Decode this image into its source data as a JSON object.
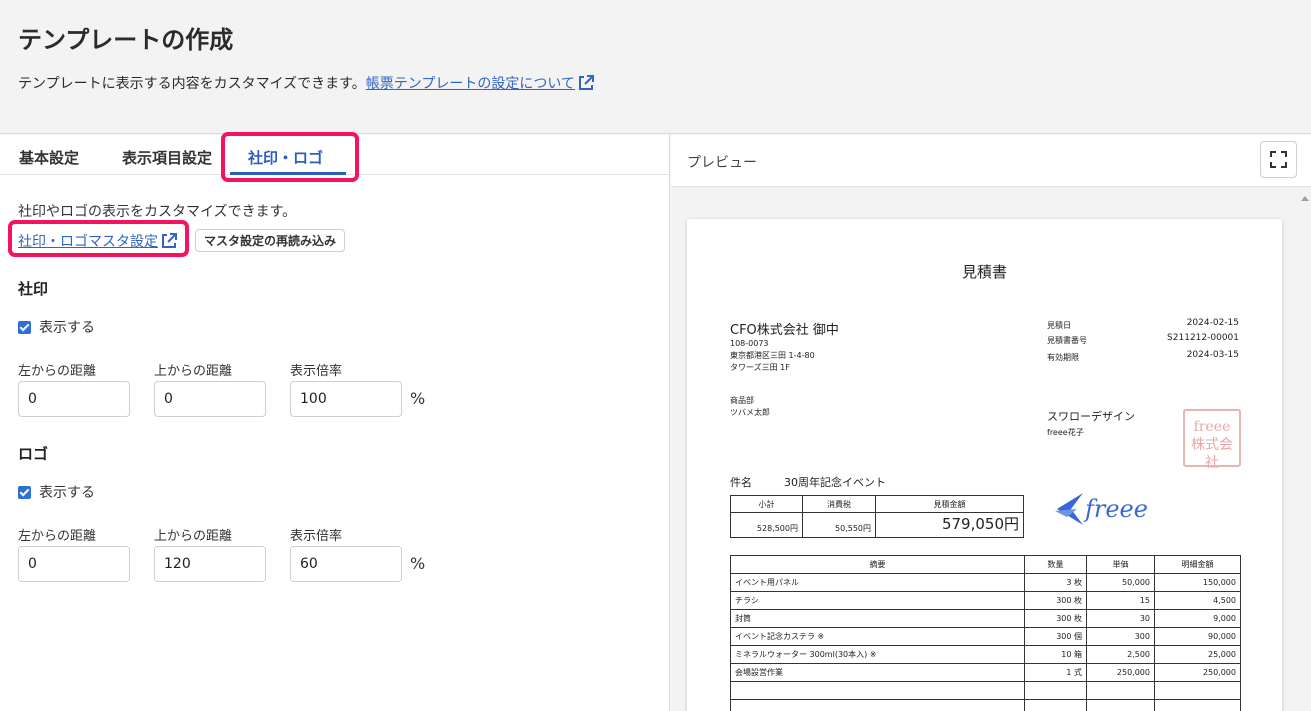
{
  "header": {
    "title": "テンプレートの作成",
    "description": "テンプレートに表示する内容をカスタマイズできます。",
    "help_link": "帳票テンプレートの設定について"
  },
  "tabs": [
    {
      "label": "基本設定"
    },
    {
      "label": "表示項目設定"
    },
    {
      "label": "社印・ロゴ",
      "active": true
    }
  ],
  "panel": {
    "description": "社印やロゴの表示をカスタマイズできます。",
    "master_link": "社印・ロゴマスタ設定",
    "reload_button": "マスタ設定の再読み込み"
  },
  "seal_section": {
    "title": "社印",
    "show_label": "表示する",
    "show_checked": true,
    "left_label": "左からの距離",
    "left_value": "0",
    "top_label": "上からの距離",
    "top_value": "0",
    "scale_label": "表示倍率",
    "scale_value": "100",
    "unit": "%"
  },
  "logo_section": {
    "title": "ロゴ",
    "show_label": "表示する",
    "show_checked": true,
    "left_label": "左からの距離",
    "left_value": "0",
    "top_label": "上からの距離",
    "top_value": "120",
    "scale_label": "表示倍率",
    "scale_value": "60",
    "unit": "%"
  },
  "preview": {
    "label": "プレビュー",
    "document": {
      "title": "見積書",
      "client_name": "CFO株式会社 御中",
      "client_zip": "108-0073",
      "client_address1": "東京都港区三田 1-4-80",
      "client_address2": "タワーズ三田 1F",
      "dept": "商品部",
      "person": "ツバメ太郎",
      "meta": [
        {
          "label": "見積日",
          "value": "2024-02-15"
        },
        {
          "label": "見積書番号",
          "value": "S211212-00001"
        },
        {
          "label": "有効期限",
          "value": "2024-03-15"
        }
      ],
      "issuer": "スワローデザイン",
      "issuer_person": "freee花子",
      "seal_line1": "freee",
      "seal_line2": "株式会社",
      "subject_label": "件名",
      "subject": "30周年記念イベント",
      "summary_headers": [
        "小計",
        "消費税",
        "見積金額"
      ],
      "summary_values": [
        "528,500円",
        "50,550円",
        "579,050円"
      ],
      "logo_text": "freee",
      "item_headers": [
        "摘要",
        "数量",
        "単価",
        "明細金額"
      ],
      "items": [
        {
          "desc": "イベント用パネル",
          "qty": "3 枚",
          "price": "50,000",
          "amount": "150,000"
        },
        {
          "desc": "チラシ",
          "qty": "300 枚",
          "price": "15",
          "amount": "4,500"
        },
        {
          "desc": "封筒",
          "qty": "300 枚",
          "price": "30",
          "amount": "9,000"
        },
        {
          "desc": "イベント記念カステラ ※",
          "qty": "300 個",
          "price": "300",
          "amount": "90,000"
        },
        {
          "desc": "ミネラルウォーター 300ml(30本入) ※",
          "qty": "10 箱",
          "price": "2,500",
          "amount": "25,000"
        },
        {
          "desc": "会場設営作業",
          "qty": "1 式",
          "price": "250,000",
          "amount": "250,000"
        },
        {
          "desc": "",
          "qty": "",
          "price": "",
          "amount": ""
        },
        {
          "desc": "",
          "qty": "",
          "price": "",
          "amount": ""
        }
      ]
    }
  },
  "colors": {
    "accent": "#2c5ec2",
    "highlight": "#f3145d",
    "link": "#3164c4",
    "logo": "#3a67d8"
  }
}
